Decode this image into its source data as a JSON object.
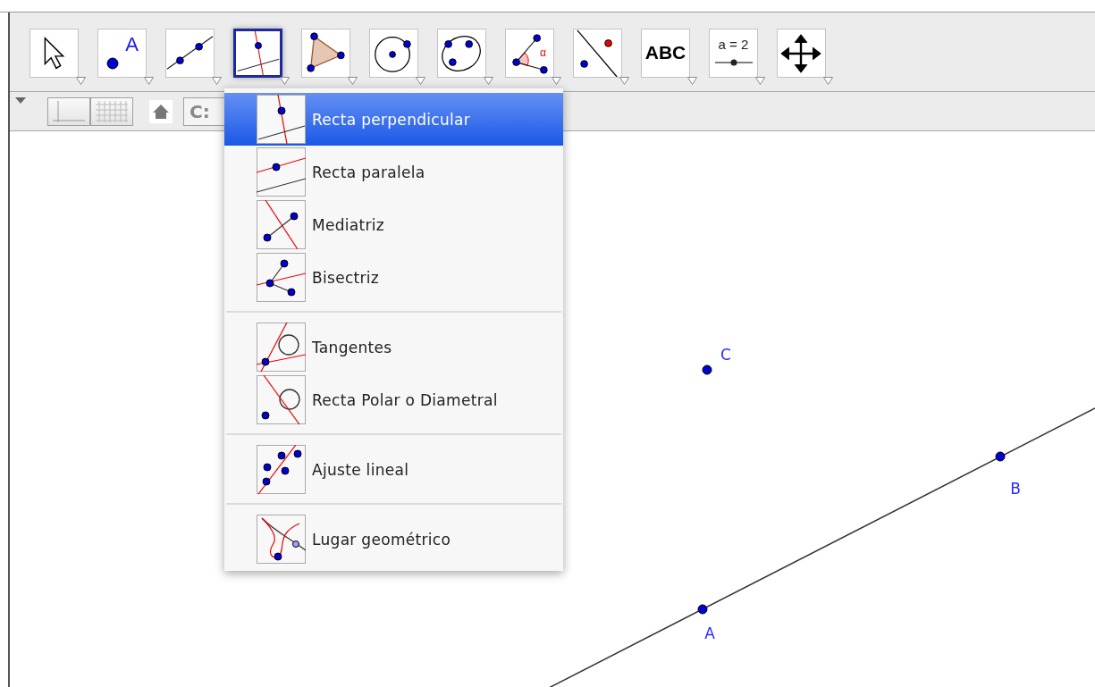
{
  "toolbar": {
    "tools": [
      {
        "kind": "move",
        "selected": false
      },
      {
        "kind": "point",
        "label": "A",
        "selected": false
      },
      {
        "kind": "line",
        "selected": false
      },
      {
        "kind": "perpendicular",
        "selected": true
      },
      {
        "kind": "polygon",
        "selected": false
      },
      {
        "kind": "circle",
        "selected": false
      },
      {
        "kind": "conic",
        "selected": false
      },
      {
        "kind": "angle",
        "label": "α",
        "selected": false
      },
      {
        "kind": "reflect",
        "selected": false
      },
      {
        "kind": "text",
        "label": "ABC",
        "selected": false
      },
      {
        "kind": "slider",
        "label": "a = 2",
        "selected": false
      },
      {
        "kind": "move-view",
        "selected": false
      }
    ]
  },
  "view_bar": {
    "style_button": "C:"
  },
  "tool_menu": {
    "groups": [
      {
        "items": [
          {
            "kind": "perpendicular",
            "label": "Recta perpendicular",
            "selected": true
          },
          {
            "kind": "parallel",
            "label": "Recta paralela",
            "selected": false
          },
          {
            "kind": "perp-bisector",
            "label": "Mediatriz",
            "selected": false
          },
          {
            "kind": "angle-bisector",
            "label": "Bisectriz",
            "selected": false
          }
        ]
      },
      {
        "items": [
          {
            "kind": "tangents",
            "label": "Tangentes",
            "selected": false
          },
          {
            "kind": "polar",
            "label": "Recta Polar o Diametral",
            "selected": false
          }
        ]
      },
      {
        "items": [
          {
            "kind": "fit-line",
            "label": "Ajuste lineal",
            "selected": false
          }
        ]
      },
      {
        "items": [
          {
            "kind": "locus",
            "label": "Lugar geométrico",
            "selected": false
          }
        ]
      }
    ]
  },
  "canvas": {
    "points": [
      {
        "label": "C"
      },
      {
        "label": "B"
      },
      {
        "label": "A"
      }
    ]
  }
}
